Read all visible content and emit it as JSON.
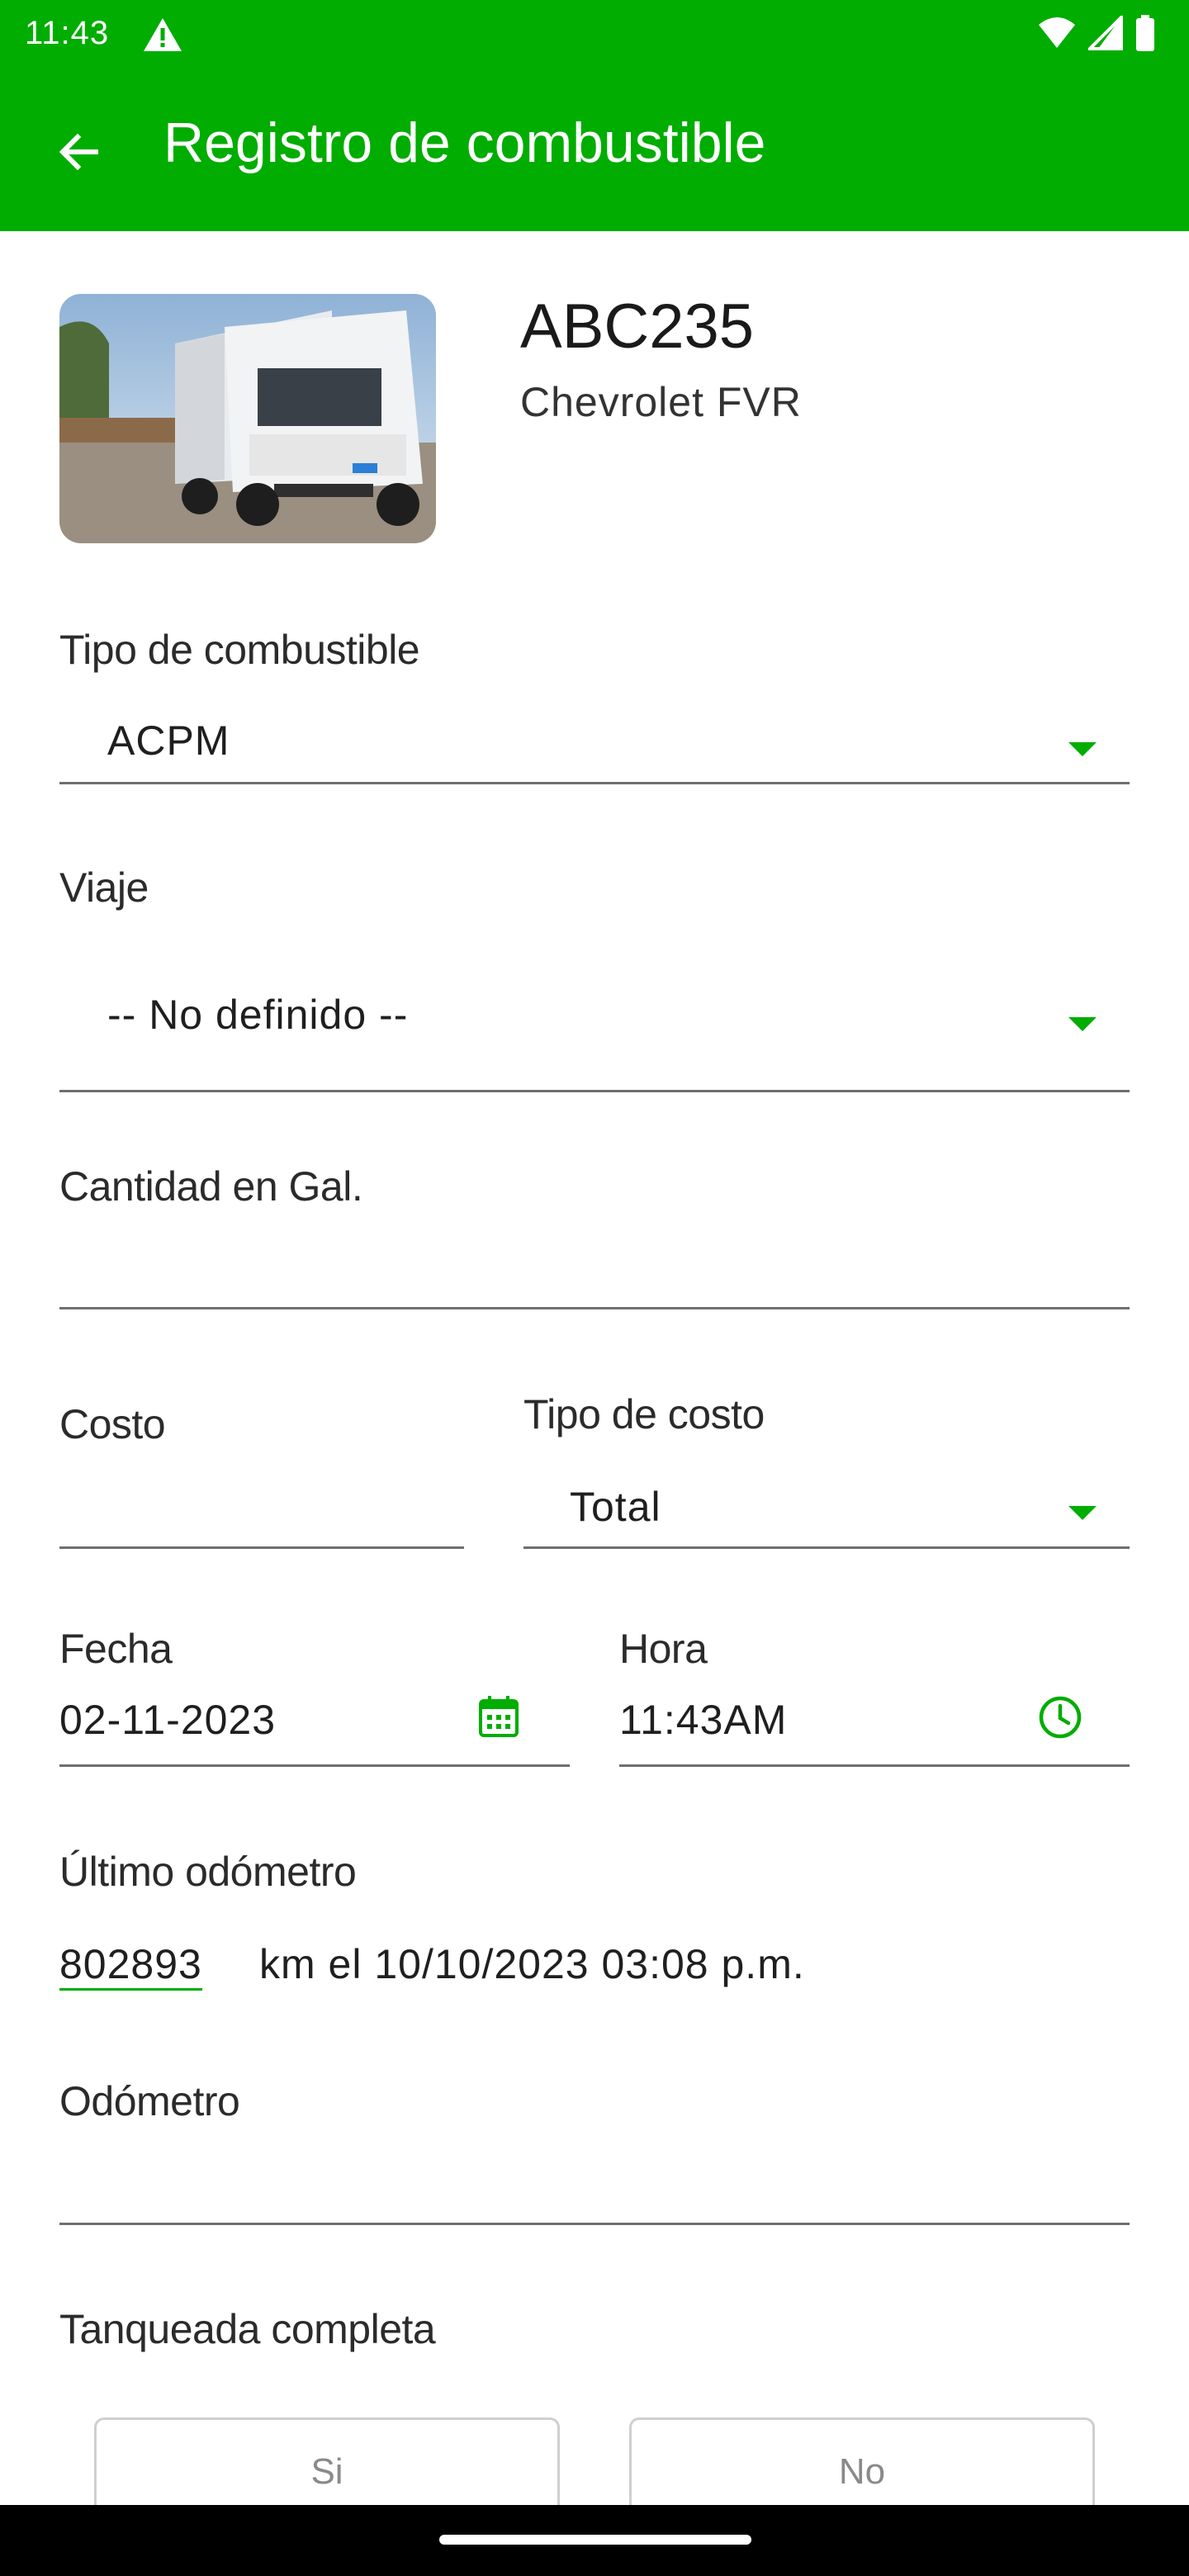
{
  "status_bar": {
    "time": "11:43",
    "icons": [
      "alert-triangle-icon",
      "wifi-icon",
      "cell-signal-icon",
      "battery-icon"
    ]
  },
  "app_bar": {
    "title": "Registro de combustible",
    "back_icon": "arrow-left-icon"
  },
  "vehicle": {
    "plate": "ABC235",
    "model": "Chevrolet FVR"
  },
  "form": {
    "fuel_type": {
      "label": "Tipo de combustible",
      "value": "ACPM"
    },
    "trip": {
      "label": "Viaje",
      "value": "-- No definido --"
    },
    "quantity": {
      "label": "Cantidad en Gal.",
      "value": ""
    },
    "cost": {
      "label": "Costo",
      "value": ""
    },
    "cost_type": {
      "label": "Tipo de costo",
      "value": "Total"
    },
    "date": {
      "label": "Fecha",
      "value": "02-11-2023",
      "icon": "calendar-icon"
    },
    "time": {
      "label": "Hora",
      "value": "11:43AM",
      "icon": "clock-icon"
    },
    "last_odometer": {
      "label": "Último odómetro",
      "value": "802893",
      "suffix": "km el 10/10/2023 03:08 p.m."
    },
    "odometer": {
      "label": "Odómetro",
      "value": ""
    },
    "full_tank": {
      "label": "Tanqueada completa",
      "yes_label": "Si",
      "no_label": "No"
    }
  },
  "colors": {
    "brand_green": "#00ad00",
    "text": "#1f1f1f",
    "underline": "#6f6f6f"
  }
}
